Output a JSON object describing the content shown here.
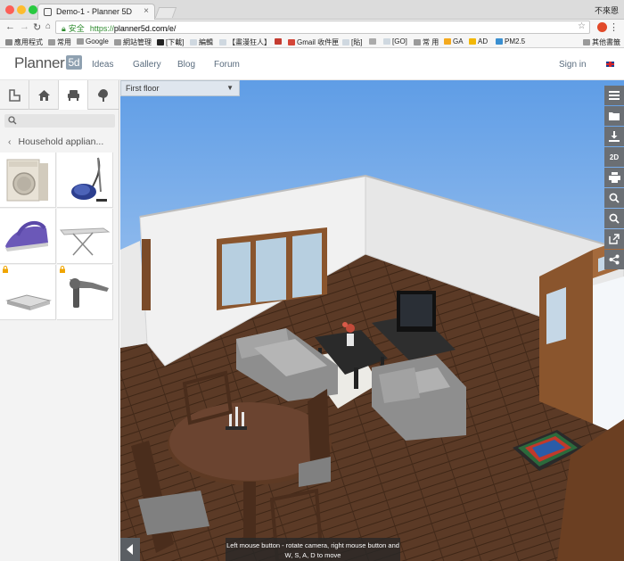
{
  "browser": {
    "tab_title": "Demo-1 - Planner 5D",
    "tab_close": "×",
    "user_name": "不來恩",
    "secure_label": "安全",
    "url_scheme": "https://",
    "url_rest": "planner5d.com/e/",
    "bookmarks": [
      "應用程式",
      "常用",
      "Google",
      "網站管理",
      "[下載]",
      "編輯",
      "【畫漫狂人】",
      "Gmail 收件匣",
      "[貼]",
      "[GO]",
      "常 用",
      "GA",
      "AD",
      "PM2.5",
      "其他書籤"
    ]
  },
  "header": {
    "logo_text": "Planner",
    "logo_box": "5d",
    "nav": [
      "Ideas",
      "Gallery",
      "Blog",
      "Forum"
    ],
    "signin": "Sign in"
  },
  "left_panel": {
    "tabs": [
      "floorplan-icon",
      "home-icon",
      "furniture-icon",
      "tree-icon"
    ],
    "category": "Household applian...",
    "items": [
      {
        "name": "Washing machine",
        "locked": false
      },
      {
        "name": "Vacuum cleaner",
        "locked": false
      },
      {
        "name": "Iron",
        "locked": false
      },
      {
        "name": "Ironing board",
        "locked": false
      },
      {
        "name": "Scale",
        "locked": true
      },
      {
        "name": "Hair dryer",
        "locked": true
      }
    ]
  },
  "viewport": {
    "floor_select": "First floor",
    "tools": [
      "menu-icon",
      "folder-icon",
      "download-icon",
      "2D",
      "print-icon",
      "zoom-in-icon",
      "zoom-out-icon",
      "external-link-icon",
      "share-icon"
    ],
    "hint_line1": "Left mouse button - rotate camera, right mouse button and",
    "hint_line2": "W, S, A, D to move"
  }
}
